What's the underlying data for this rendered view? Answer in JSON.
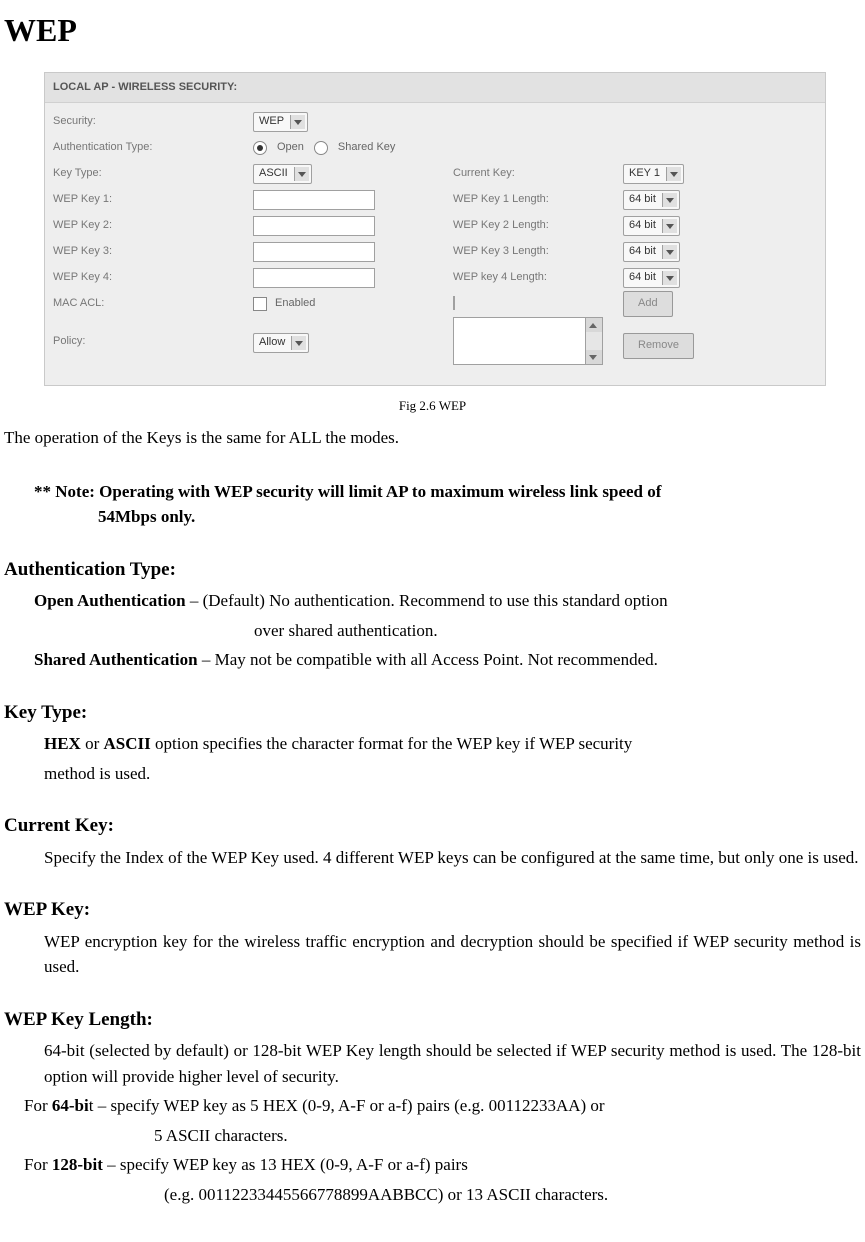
{
  "title": "WEP",
  "panel": {
    "header": "LOCAL AP - WIRELESS SECURITY:",
    "security_label": "Security:",
    "security_value": "WEP",
    "auth_label": "Authentication Type:",
    "open_label": "Open",
    "shared_label": "Shared Key",
    "keytype_label": "Key Type:",
    "keytype_value": "ASCII",
    "currentkey_label": "Current Key:",
    "currentkey_value": "KEY 1",
    "wepkey1_label": "WEP Key 1:",
    "wepkey1len_label": "WEP Key 1 Length:",
    "wepkey2_label": "WEP Key 2:",
    "wepkey2len_label": "WEP Key 2 Length:",
    "wepkey3_label": "WEP Key 3:",
    "wepkey3len_label": "WEP Key 3 Length:",
    "wepkey4_label": "WEP Key 4:",
    "wepkey4len_label": "WEP key 4 Length:",
    "len_value": "64 bit",
    "macacl_label": "MAC ACL:",
    "enabled_label": "Enabled",
    "add_label": "Add",
    "policy_label": "Policy:",
    "policy_value": "Allow",
    "remove_label": "Remove"
  },
  "caption": "Fig 2.6 WEP",
  "intro": "The operation of the Keys is the same for ALL the modes.",
  "note_line1": "** Note: Operating with WEP security will limit AP to maximum wireless link speed of",
  "note_line2": "54Mbps only.",
  "auth": {
    "heading": "Authentication Type:",
    "open_name": "Open Authentication",
    "open_desc1": " – (Default) No authentication. Recommend to use this standard option",
    "open_desc2": "over shared authentication.",
    "shared_name": "Shared Authentication",
    "shared_desc": " – May not be compatible with all Access Point. Not recommended."
  },
  "keytype": {
    "heading": "Key Type:",
    "hex": "HEX",
    "or": " or ",
    "ascii": "ASCII",
    "desc1": " option specifies the character format for the WEP key if WEP security",
    "desc2": "method is used."
  },
  "currentkey": {
    "heading": "Current Key:",
    "desc": "Specify the Index of the WEP Key used. 4 different WEP keys can be configured at the same time, but only one is used."
  },
  "wepkey": {
    "heading": "WEP Key:",
    "desc": "WEP encryption key for the wireless traffic encryption and decryption should be specified if WEP security method is used."
  },
  "wepkeylen": {
    "heading": "WEP Key Length:",
    "desc": "64-bit (selected by default) or 128-bit WEP Key length should be selected if WEP security method is used. The 128-bit option will provide higher level of security.",
    "for64_pre": "For ",
    "for64_b": "64-bi",
    "for64_t": "t – specify WEP key as 5 HEX (0-9, A-F or a-f) pairs (e.g. 00112233AA) or",
    "for64_sub": "5 ASCII characters.",
    "for128_pre": "For ",
    "for128_b": "128-bit",
    "for128_t": " – specify WEP key as 13 HEX (0-9, A-F or a-f) pairs",
    "for128_sub": "(e.g. 00112233445566778899AABBCC) or 13 ASCII characters."
  }
}
